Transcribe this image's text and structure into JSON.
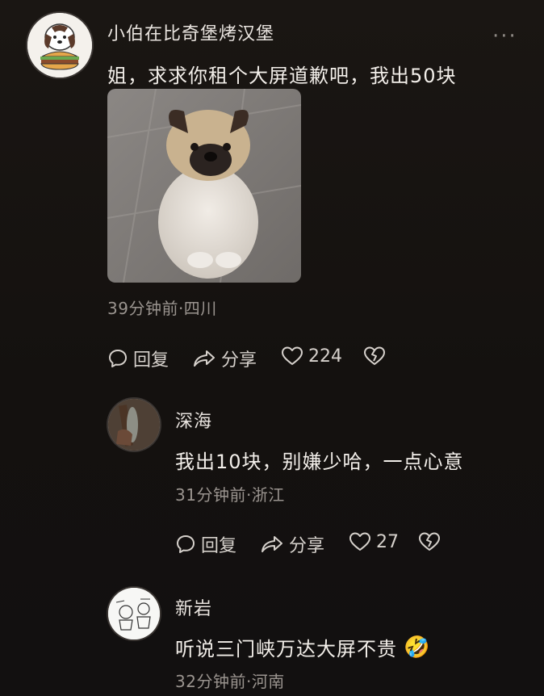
{
  "post": {
    "author": "小伯在比奇堡烤汉堡",
    "text": "姐，求求你租个大屏道歉吧，我出50块",
    "meta": "39分钟前·四川",
    "actions": {
      "reply": "回复",
      "share": "分享",
      "likes": "224"
    },
    "more": "···"
  },
  "comments": [
    {
      "author": "深海",
      "text": "我出10块，别嫌少哈，一点心意",
      "meta": "31分钟前·浙江",
      "actions": {
        "reply": "回复",
        "share": "分享",
        "likes": "27"
      }
    },
    {
      "author": "新岩",
      "text": "听说三门峡万达大屏不贵",
      "emoji": "🤣",
      "meta": "32分钟前·河南"
    }
  ],
  "icons": {
    "reply": "comment-bubble-icon",
    "share": "share-arrow-icon",
    "like": "heart-icon",
    "dislike": "broken-heart-icon"
  }
}
